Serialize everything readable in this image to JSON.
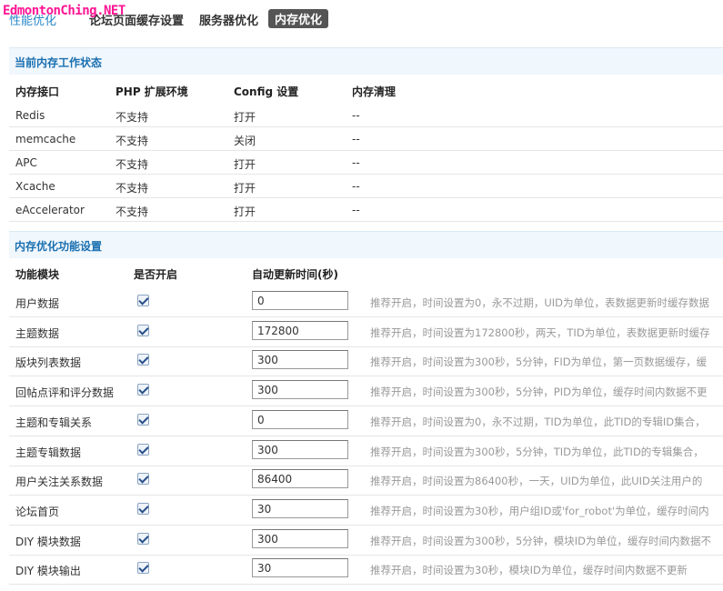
{
  "tabs": [
    {
      "label": "性能优化"
    },
    {
      "label": "论坛页面缓存设置"
    },
    {
      "label": "服务器优化"
    },
    {
      "label": "内存优化"
    }
  ],
  "watermark": "EdmontonChing.NET",
  "status_section": {
    "title": "当前内存工作状态",
    "headers": [
      "内存接口",
      "PHP 扩展环境",
      "Config 设置",
      "内存清理"
    ],
    "rows": [
      {
        "name": "Redis",
        "php": "不支持",
        "config": "打开",
        "clean": "--"
      },
      {
        "name": "memcache",
        "php": "不支持",
        "config": "关闭",
        "clean": "--"
      },
      {
        "name": "APC",
        "php": "不支持",
        "config": "打开",
        "clean": "--"
      },
      {
        "name": "Xcache",
        "php": "不支持",
        "config": "打开",
        "clean": "--"
      },
      {
        "name": "eAccelerator",
        "php": "不支持",
        "config": "打开",
        "clean": "--"
      }
    ]
  },
  "feature_section": {
    "title": "内存优化功能设置",
    "headers": [
      "功能模块",
      "是否开启",
      "自动更新时间(秒)"
    ],
    "rows": [
      {
        "name": "用户数据",
        "enabled": true,
        "value": "0",
        "hint": "推荐开启，时间设置为0，永不过期，UID为单位，表数据更新时缓存数据"
      },
      {
        "name": "主题数据",
        "enabled": true,
        "value": "172800",
        "hint": "推荐开启，时间设置为172800秒，两天，TID为单位，表数据更新时缓存"
      },
      {
        "name": "版块列表数据",
        "enabled": true,
        "value": "300",
        "hint": "推荐开启，时间设置为300秒，5分钟，FID为单位，第一页数据缓存，缓"
      },
      {
        "name": "回帖点评和评分数据",
        "enabled": true,
        "value": "300",
        "hint": "推荐开启，时间设置为300秒，5分钟，PID为单位，缓存时间内数据不更"
      },
      {
        "name": "主题和专辑关系",
        "enabled": true,
        "value": "0",
        "hint": "推荐开启，时间设置为0，永不过期，TID为单位，此TID的专辑ID集合，"
      },
      {
        "name": "主题专辑数据",
        "enabled": true,
        "value": "300",
        "hint": "推荐开启，时间设置为300秒，5分钟，TID为单位，此TID的专辑集合，"
      },
      {
        "name": "用户关注关系数据",
        "enabled": true,
        "value": "86400",
        "hint": "推荐开启，时间设置为86400秒，一天，UID为单位，此UID关注用户的"
      },
      {
        "name": "论坛首页",
        "enabled": true,
        "value": "30",
        "hint": "推荐开启，时间设置为30秒，用户组ID或'for_robot'为单位，缓存时间内"
      },
      {
        "name": "DIY 模块数据",
        "enabled": true,
        "value": "300",
        "hint": "推荐开启，时间设置为300秒，5分钟，模块ID为单位，缓存时间内数据不"
      },
      {
        "name": "DIY 模块输出",
        "enabled": true,
        "value": "30",
        "hint": "推荐开启，时间设置为30秒，模块ID为单位，缓存时间内数据不更新"
      }
    ]
  }
}
